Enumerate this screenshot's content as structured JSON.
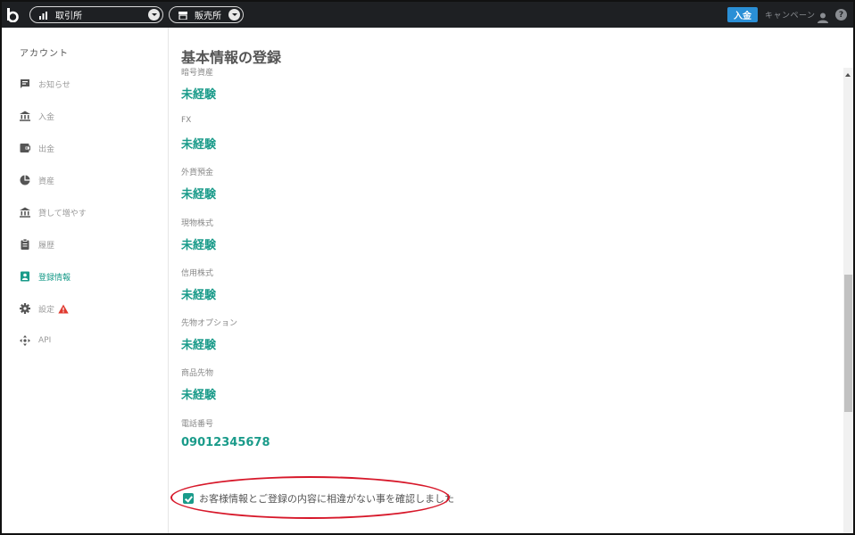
{
  "topbar": {
    "exchange_label": "取引所",
    "store_label": "販売所",
    "deposit_button": "入金",
    "campaign_link": "キャンペーン"
  },
  "sidebar": {
    "title": "アカウント",
    "items": [
      {
        "label": "お知らせ",
        "icon": "notice-icon"
      },
      {
        "label": "入金",
        "icon": "bank-icon"
      },
      {
        "label": "出金",
        "icon": "wallet-icon"
      },
      {
        "label": "資産",
        "icon": "pie-chart-icon"
      },
      {
        "label": "貸して増やす",
        "icon": "bank-icon"
      },
      {
        "label": "履歴",
        "icon": "clipboard-icon"
      },
      {
        "label": "登録情報",
        "icon": "id-card-icon"
      },
      {
        "label": "設定",
        "icon": "gear-icon"
      },
      {
        "label": "API",
        "icon": "api-icon"
      }
    ],
    "active_index": 6,
    "warning_on": "設定"
  },
  "main": {
    "title": "基本情報の登録",
    "fields": [
      {
        "label": "暗号資産",
        "value": "未経験"
      },
      {
        "label": "FX",
        "value": "未経験"
      },
      {
        "label": "外貨預金",
        "value": "未経験"
      },
      {
        "label": "現物株式",
        "value": "未経験"
      },
      {
        "label": "信用株式",
        "value": "未経験"
      },
      {
        "label": "先物オプション",
        "value": "未経験"
      },
      {
        "label": "商品先物",
        "value": "未経験"
      },
      {
        "label": "電話番号",
        "value": "09012345678"
      }
    ],
    "confirm_checkbox": {
      "checked": true,
      "label": "お客様情報とご登録の内容に相違がない事を確認しました"
    }
  },
  "colors": {
    "accent": "#1a9b8a",
    "topbar": "#1e2023",
    "deposit_button": "#2a8fd6",
    "highlight": "#d7182a",
    "warning": "#e03a2f"
  }
}
